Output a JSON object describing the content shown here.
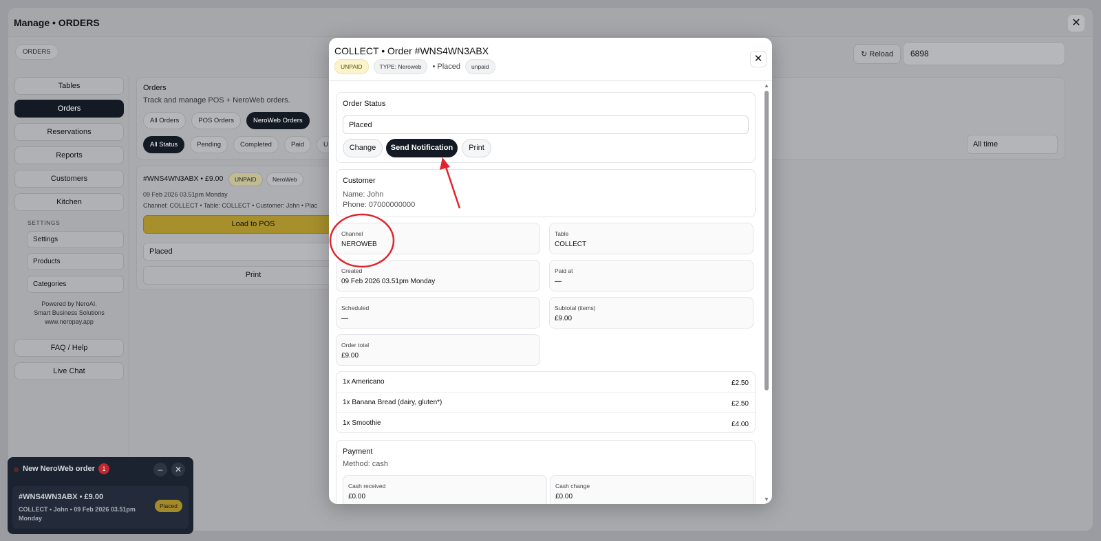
{
  "backdrop": {
    "title": "Manage • ORDERS",
    "close_glyph": "✕",
    "orders_chip": "ORDERS",
    "reload_label": "↻ Reload",
    "search_value": "6898",
    "sidebar": {
      "items": [
        "Tables",
        "Orders",
        "Reservations",
        "Reports",
        "Customers",
        "Kitchen"
      ],
      "settings_label": "SETTINGS",
      "settings_items": [
        "Settings",
        "Products",
        "Categories"
      ],
      "powered_lines": [
        "Powered by NeroAI.",
        "Smart Business Solutions",
        "www.neropay.app"
      ],
      "faq": "FAQ / Help",
      "live_chat": "Live Chat"
    },
    "content": {
      "heading": "Orders",
      "subheading": "Track and manage POS + NeroWeb orders.",
      "type_filters": [
        "All Orders",
        "POS Orders",
        "NeroWeb Orders"
      ],
      "status_filters": [
        "All Status",
        "Pending",
        "Completed",
        "Paid",
        "U"
      ],
      "time_filter": "All time",
      "order_card": {
        "title": "#WNS4WN3ABX • £9.00",
        "badge_unpaid": "UNPAID",
        "badge_type": "NeroWeb",
        "date": "09 Feb 2026 03.51pm Monday",
        "meta": "Channel: COLLECT • Table: COLLECT • Customer: John • Plac",
        "load_label": "Load to POS",
        "status_value": "Placed",
        "print_label": "Print"
      }
    },
    "toast": {
      "title": "New NeroWeb order",
      "count": "1",
      "minimize": "–",
      "close": "✕",
      "order": "#WNS4WN3ABX • £9.00",
      "meta": "COLLECT • John • 09 Feb 2026 03.51pm Monday",
      "status": "Placed"
    }
  },
  "modal": {
    "title": "COLLECT • Order #WNS4WN3ABX",
    "badges": {
      "unpaid": "UNPAID",
      "type": "TYPE: Neroweb",
      "placed": "• Placed",
      "payment": "unpaid"
    },
    "close_glyph": "✕",
    "order_status": {
      "title": "Order Status",
      "value": "Placed",
      "change_label": "Change",
      "notify_label": "Send Notification",
      "print_label": "Print"
    },
    "customer": {
      "title": "Customer",
      "name": "Name: John",
      "phone": "Phone: 07000000000"
    },
    "fields": {
      "channel": {
        "label": "Channel",
        "value": "NEROWEB"
      },
      "table": {
        "label": "Table",
        "value": "COLLECT"
      },
      "created": {
        "label": "Created",
        "value": "09 Feb 2026 03.51pm Monday"
      },
      "paid_at": {
        "label": "Paid at",
        "value": "—"
      },
      "scheduled": {
        "label": "Scheduled",
        "value": "—"
      },
      "subtotal": {
        "label": "Subtotal (items)",
        "value": "£9.00"
      },
      "order_total": {
        "label": "Order total",
        "value": "£9.00"
      }
    },
    "items": [
      {
        "name": "1x Americano",
        "price": "£2.50"
      },
      {
        "name": "1x Banana Bread (dairy, gluten*)",
        "price": "£2.50"
      },
      {
        "name": "1x Smoothie",
        "price": "£4.00"
      }
    ],
    "payment": {
      "title": "Payment",
      "method": "Method: cash",
      "cash_received": {
        "label": "Cash received",
        "value": "£0.00"
      },
      "cash_change": {
        "label": "Cash change",
        "value": "£0.00"
      }
    }
  },
  "colors": {
    "accent_dark": "#141a24",
    "annotation_red": "#e0242b",
    "unpaid_badge": "#fbf3c9",
    "load_pos": "#a7902c"
  }
}
